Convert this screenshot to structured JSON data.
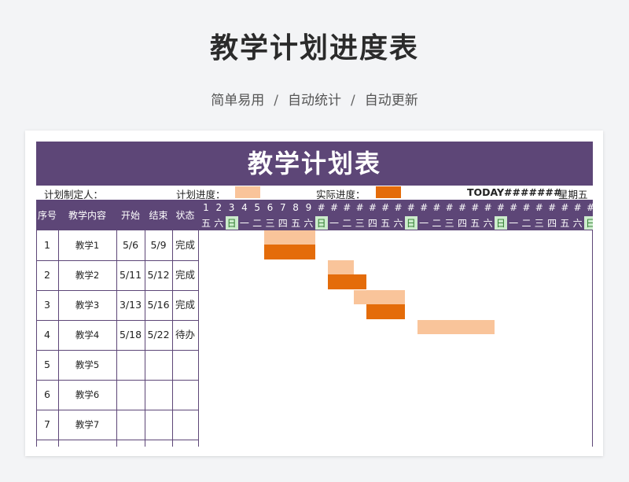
{
  "hero": {
    "title": "教学计划进度表",
    "tags": [
      "简单易用",
      "自动统计",
      "自动更新"
    ],
    "separator": "/"
  },
  "sheet": {
    "title": "教学计划表",
    "info": {
      "planner_label": "计划制定人：",
      "plan_progress_label": "计划进度：",
      "actual_progress_label": "实际进度：",
      "today_text": "TODAY#######",
      "weekday_text": "星期五"
    },
    "columns": [
      "序号",
      "教学内容",
      "开始",
      "结束",
      "状态"
    ],
    "day_numbers": [
      "1",
      "2",
      "3",
      "4",
      "5",
      "6",
      "7",
      "8",
      "9",
      "#",
      "#",
      "#",
      "#",
      "#",
      "#",
      "#",
      "#",
      "#",
      "#",
      "#",
      "#",
      "#",
      "#",
      "#",
      "#",
      "#",
      "#",
      "#",
      "#",
      "#",
      "#"
    ],
    "weekdays": [
      "五",
      "六",
      "日",
      "一",
      "二",
      "三",
      "四",
      "五",
      "六",
      "日",
      "一",
      "二",
      "三",
      "四",
      "五",
      "六",
      "日",
      "一",
      "二",
      "三",
      "四",
      "五",
      "六",
      "日",
      "一",
      "二",
      "三",
      "四",
      "五",
      "六",
      "日"
    ],
    "rows": [
      {
        "no": "1",
        "content": "教学1",
        "start": "5/6",
        "end": "5/9",
        "status": "完成"
      },
      {
        "no": "2",
        "content": "教学2",
        "start": "5/11",
        "end": "5/12",
        "status": "完成"
      },
      {
        "no": "3",
        "content": "教学3",
        "start": "3/13",
        "end": "5/16",
        "status": "完成"
      },
      {
        "no": "4",
        "content": "教学4",
        "start": "5/18",
        "end": "5/22",
        "status": "待办"
      },
      {
        "no": "5",
        "content": "教学5",
        "start": "",
        "end": "",
        "status": ""
      },
      {
        "no": "6",
        "content": "教学6",
        "start": "",
        "end": "",
        "status": ""
      },
      {
        "no": "7",
        "content": "教学7",
        "start": "",
        "end": "",
        "status": ""
      }
    ],
    "gantt": [
      {
        "row": 1,
        "plan": [
          6,
          9
        ],
        "actual": [
          6,
          9
        ]
      },
      {
        "row": 2,
        "plan": [
          11,
          12
        ],
        "actual": [
          11,
          13
        ]
      },
      {
        "row": 3,
        "plan": [
          13,
          16
        ],
        "actual": [
          14,
          16
        ]
      },
      {
        "row": 4,
        "plan": [
          18,
          23
        ],
        "actual": null
      }
    ],
    "colors": {
      "primary": "#5d4677",
      "plan": "#f9c49a",
      "actual": "#e46c0a",
      "sunday": "#cdeccd"
    }
  }
}
